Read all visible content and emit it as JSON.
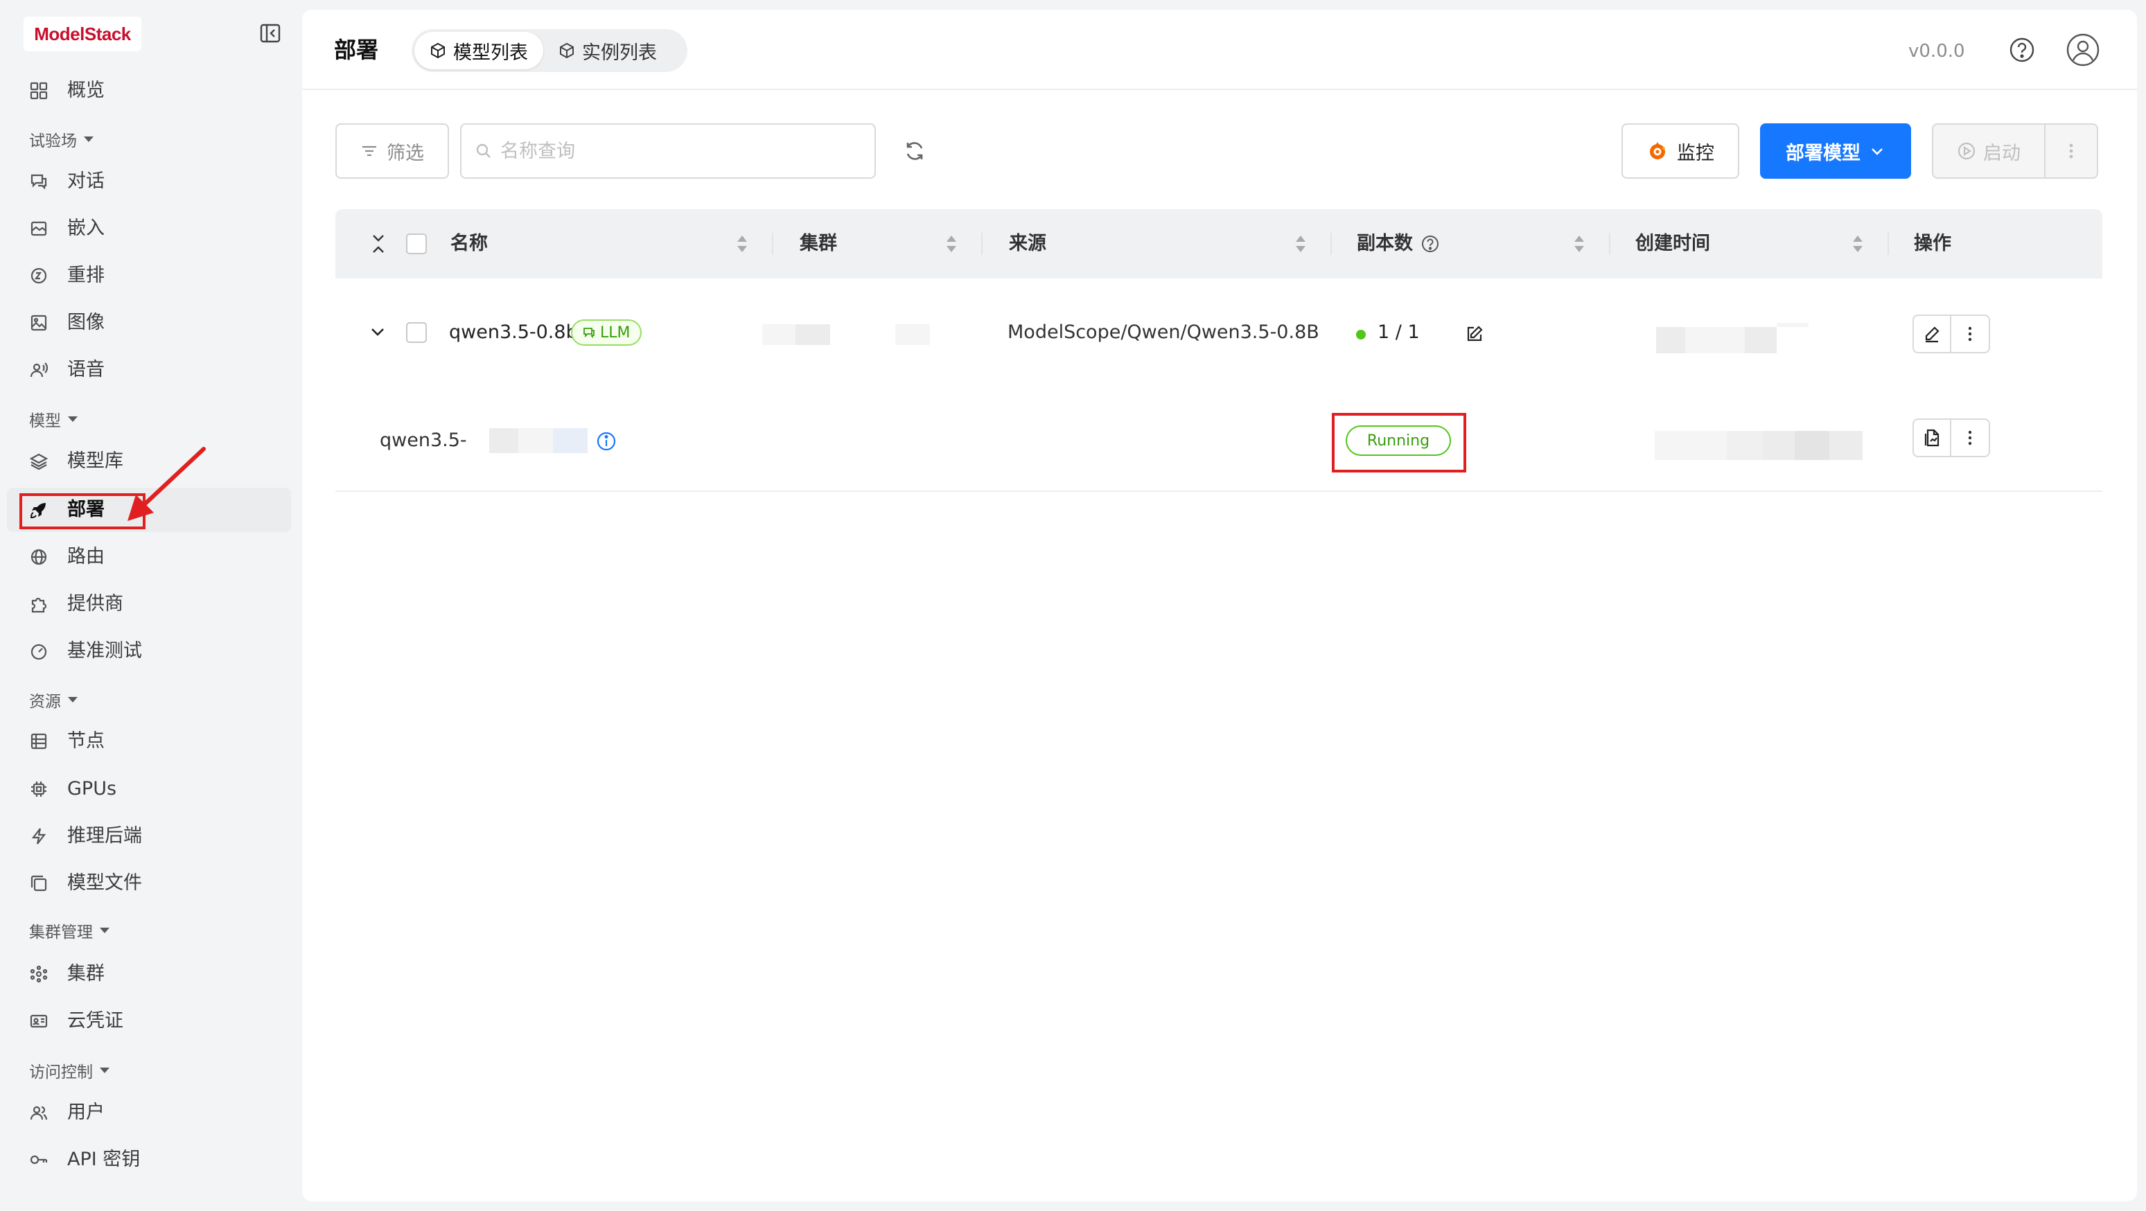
{
  "brand": {
    "logo_text": "ModelStack"
  },
  "sidebar": {
    "items": [
      {
        "label": "概览",
        "icon": "grid-icon"
      },
      {
        "group": "试验场"
      },
      {
        "label": "对话",
        "icon": "chat-icon"
      },
      {
        "label": "嵌入",
        "icon": "embed-icon"
      },
      {
        "label": "重排",
        "icon": "rerank-icon"
      },
      {
        "label": "图像",
        "icon": "image-icon"
      },
      {
        "label": "语音",
        "icon": "voice-icon"
      },
      {
        "group": "模型"
      },
      {
        "label": "模型库",
        "icon": "layers-icon"
      },
      {
        "label": "部署",
        "icon": "rocket-icon",
        "active": true
      },
      {
        "label": "路由",
        "icon": "globe-icon"
      },
      {
        "label": "提供商",
        "icon": "puzzle-icon"
      },
      {
        "label": "基准测试",
        "icon": "gauge-icon"
      },
      {
        "group": "资源"
      },
      {
        "label": "节点",
        "icon": "server-icon"
      },
      {
        "label": "GPUs",
        "icon": "chip-icon"
      },
      {
        "label": "推理后端",
        "icon": "bolt-icon"
      },
      {
        "label": "模型文件",
        "icon": "files-icon"
      },
      {
        "group": "集群管理"
      },
      {
        "label": "集群",
        "icon": "cluster-icon"
      },
      {
        "label": "云凭证",
        "icon": "id-card-icon"
      },
      {
        "group": "访问控制"
      },
      {
        "label": "用户",
        "icon": "users-icon"
      },
      {
        "label": "API 密钥",
        "icon": "key-icon"
      }
    ]
  },
  "header": {
    "title": "部署",
    "tabs": [
      {
        "label": "模型列表",
        "active": true
      },
      {
        "label": "实例列表",
        "active": false
      }
    ],
    "version": "v0.0.0"
  },
  "toolbar": {
    "filter_label": "筛选",
    "search_placeholder": "名称查询",
    "monitor_label": "监控",
    "deploy_label": "部署模型",
    "start_label": "启动"
  },
  "table": {
    "columns": {
      "name": "名称",
      "cluster": "集群",
      "source": "来源",
      "replicas": "副本数",
      "created": "创建时间",
      "actions": "操作"
    },
    "rows": [
      {
        "name": "qwen3.5-0.8b",
        "category": "LLM",
        "source": "ModelScope/Qwen/Qwen3.5-0.8B",
        "replicas": "1 / 1",
        "instances": [
          {
            "name_prefix": "qwen3.5-",
            "status": "Running"
          }
        ]
      }
    ]
  },
  "colors": {
    "accent": "#1677ff",
    "success": "#52c41a",
    "annotation": "#e02020",
    "brand": "#c8102e"
  }
}
